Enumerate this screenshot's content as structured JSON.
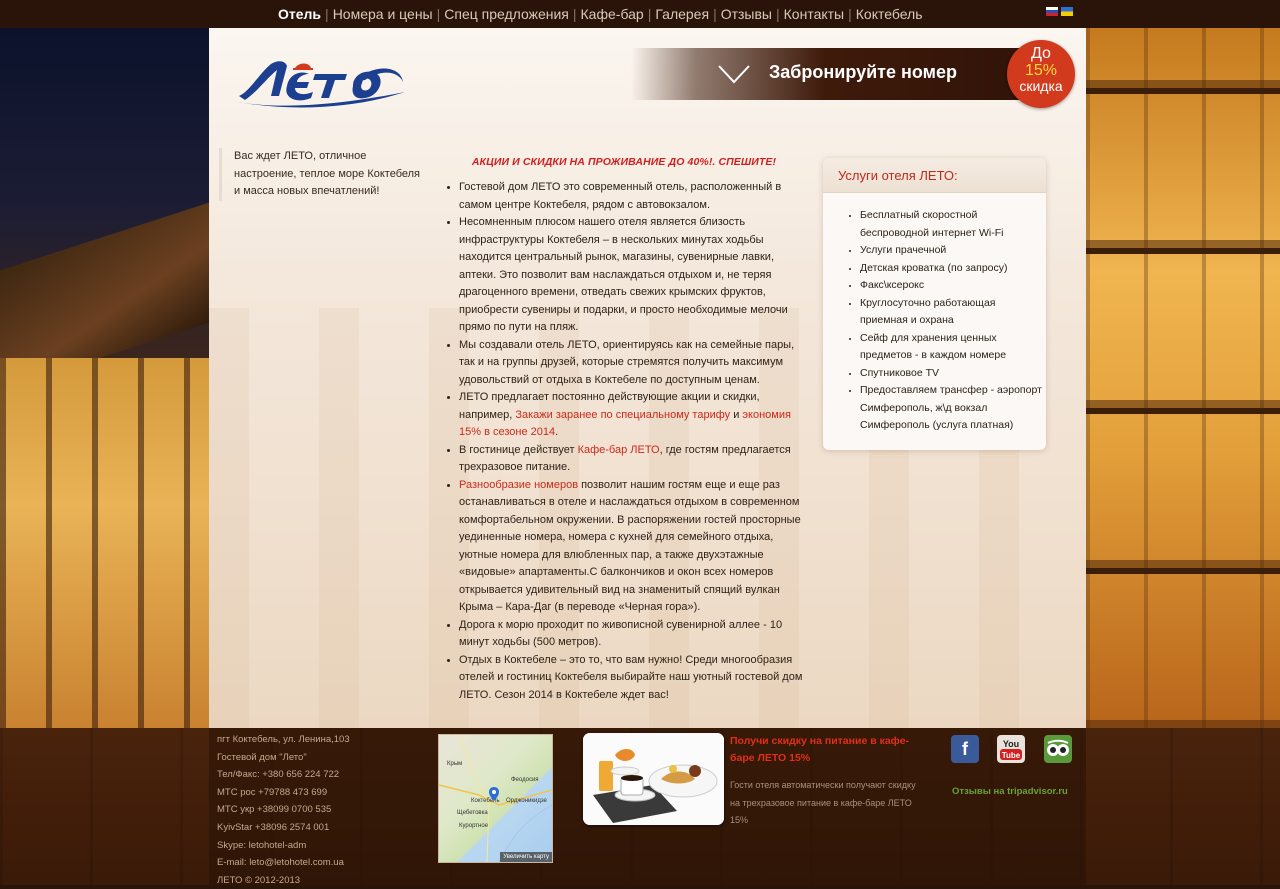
{
  "nav": {
    "items": [
      {
        "label": "Отель",
        "active": true
      },
      {
        "label": "Номера и цены"
      },
      {
        "label": "Спец предложения"
      },
      {
        "label": "Кафе-бар"
      },
      {
        "label": "Галерея"
      },
      {
        "label": "Отзывы"
      },
      {
        "label": "Контакты"
      },
      {
        "label": "Коктебель"
      }
    ],
    "languages": [
      "ru-flag",
      "ua-flag"
    ]
  },
  "header": {
    "logo_text": "Лето",
    "booking_label": "Забронируйте номер",
    "discount": {
      "line1": "До",
      "line2": "15%",
      "line3": "скидка"
    }
  },
  "intro_text": "Вас ждет ЛЕТО, отличное настроение, теплое море Коктебеля и масса новых впечатлений!",
  "main": {
    "promo_heading": "АКЦИИ И СКИДКИ НА ПРОЖИВАНИЕ ДО 40%!. СПЕШИТЕ!",
    "p1": "Гостевой дом ЛЕТО это современный отель, расположенный в самом центре Коктебеля, рядом с автовокзалом.",
    "p2": "Несомненным плюсом нашего отеля является близость инфраструктуры Коктебеля – в нескольких минутах ходьбы находится центральный рынок, магазины, сувенирные лавки, аптеки. Это позволит вам наслаждаться отдыхом и, не теряя драгоценного времени, отведать свежих крымских фруктов, приобрести сувениры и подарки, и просто необходимые мелочи прямо по пути на пляж.",
    "p3": "Мы создавали отель ЛЕТО, ориентируясь как на семейные пары, так и на группы друзей, которые стремятся получить максимум удовольствий от отдыха в Коктебеле по доступным ценам.",
    "p4_pre": "ЛЕТО предлагает постоянно действующие акции и скидки, например, ",
    "p4_link1": "Закажи заранее по специальному тарифу",
    "p4_mid": " и ",
    "p4_link2": "экономия 15% в сезоне 2014",
    "p4_post": ".",
    "p5_pre": "В гостинице действует ",
    "p5_link": "Кафе-бар ЛЕТО",
    "p5_post": ", где гостям предлагается трехразовое питание.",
    "p6_link": "Разнообразие номеров",
    "p6_post": " позволит нашим гостям еще и еще раз останавливаться в отеле и наслаждаться отдыхом в современном комфортабельном окружении. В распоряжении гостей просторные уединенные номера, номера с кухней для семейного отдыха, уютные номера для влюбленных пар, а также двухэтажные «видовые» апартаменты.С балкончиков и окон всех номеров открывается удивительный вид на знаменитый спящий вулкан Крыма – Кара-Даг (в переводе «Черная гора»).",
    "p7": "Дорога к морю проходит по живописной сувенирной аллее - 10 минут ходьбы (500 метров).",
    "p8": "Отдых в Коктебеле – это то, что вам нужно! Среди многообразия отелей и гостиниц Коктебеля выбирайте наш уютный гостевой дом ЛЕТО. Сезон 2014 в Коктебеле ждет вас!"
  },
  "services": {
    "title": "Услуги отеля ЛЕТО:",
    "items": [
      "Бесплатный скоростной беспроводной интернет Wi-Fi",
      "Услуги прачечной",
      "Детская кроватка (по запросу)",
      "Факс\\ксерокс",
      "Круглосуточно работающая приемная и охрана",
      "Сейф для хранения ценных предметов - в каждом номере",
      "Спутниковое TV",
      "Предоставляем трансфер - аэропорт Симферополь, ж\\д вокзал Симферополь (услуга платная)"
    ]
  },
  "footer": {
    "contacts": [
      "пгт Коктебель, ул. Ленина,103",
      "Гостевой дом \"Лето\"",
      "Тел/Факс: +380 656 224 722",
      "МТС рос +79788 473 699",
      "МТС укр +38099 0700 535",
      "KyivStar +38096 2574 001",
      "Skype: letohotel-adm",
      "E-mail: leto@letohotel.com.ua",
      "ЛЕТО © 2012-2013"
    ],
    "map": {
      "labels": [
        "Крым",
        "Феодосия",
        "Коктебель",
        "Орджоникидзе",
        "Щебетовка",
        "Курортное"
      ],
      "enlarge": "Увеличить карту"
    },
    "promo_title": "Получи скидку на питание в кафе-баре ЛЕТО 15%",
    "promo_text": "Гости отеля автоматически получают скидку на трехразовое питание в кафе-баре ЛЕТО 15%",
    "social": {
      "facebook": "f",
      "youtube_1": "You",
      "youtube_2": "Tube"
    },
    "tripadvisor_link": "Отзывы на tripadvisor.ru"
  }
}
